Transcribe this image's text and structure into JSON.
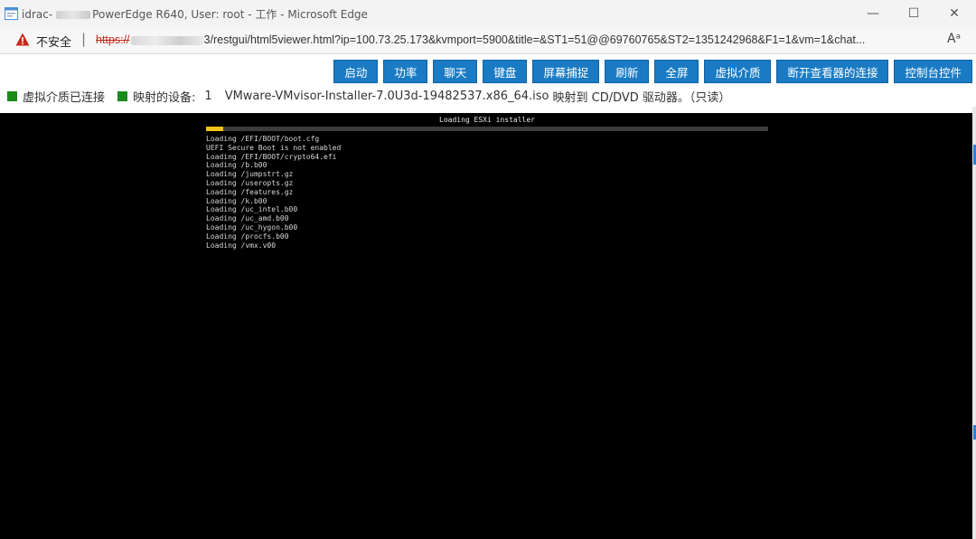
{
  "window": {
    "title_prefix": "idrac-",
    "title_rest": "PowerEdge R640, User: root - 工作 - Microsoft Edge",
    "controls": {
      "minimize": "—",
      "maximize": "☐",
      "close": "✕"
    }
  },
  "addressbar": {
    "insecure_label": "不安全",
    "separator": "|",
    "url_scheme": "https://",
    "url_suffix": "3/restgui/html5viewer.html?ip=100.73.25.173&kvmport=5900&title=&ST1=51@@69760765&ST2=1351242968&F1=1&vm=1&chat...",
    "read_aloud": "Aᵃ"
  },
  "toolbar": {
    "buttons": [
      "启动",
      "功率",
      "聊天",
      "键盘",
      "屏幕捕捉",
      "刷新",
      "全屏",
      "虚拟介质",
      "断开查看器的连接",
      "控制台控件"
    ]
  },
  "status": {
    "virtual_media": "虚拟介质已连接",
    "mapped_label": "映射的设备:",
    "mapped_count": "1",
    "mapped_file": "VMware-VMvisor-Installer-7.0U3d-19482537.x86_64.iso",
    "mapped_suffix": "映射到 CD/DVD 驱动器。（只读）"
  },
  "console": {
    "title": "Loading ESXi installer",
    "progress": 0.03,
    "lines": [
      "Loading /EFI/BOOT/boot.cfg",
      "UEFI Secure Boot is not enabled",
      "Loading /EFI/BOOT/crypto64.efi",
      "Loading /b.b00",
      "Loading /jumpstrt.gz",
      "Loading /useropts.gz",
      "Loading /features.gz",
      "Loading /k.b00",
      "Loading /uc_intel.b00",
      "Loading /uc_amd.b00",
      "Loading /uc_hygon.b00",
      "Loading /procfs.b00",
      "Loading /vmx.v00"
    ]
  },
  "colors": {
    "button_bg": "#1a7bc4",
    "status_square": "#1a8a1a",
    "progress_fill": "#f2c31a",
    "warning": "#c42b1c"
  }
}
